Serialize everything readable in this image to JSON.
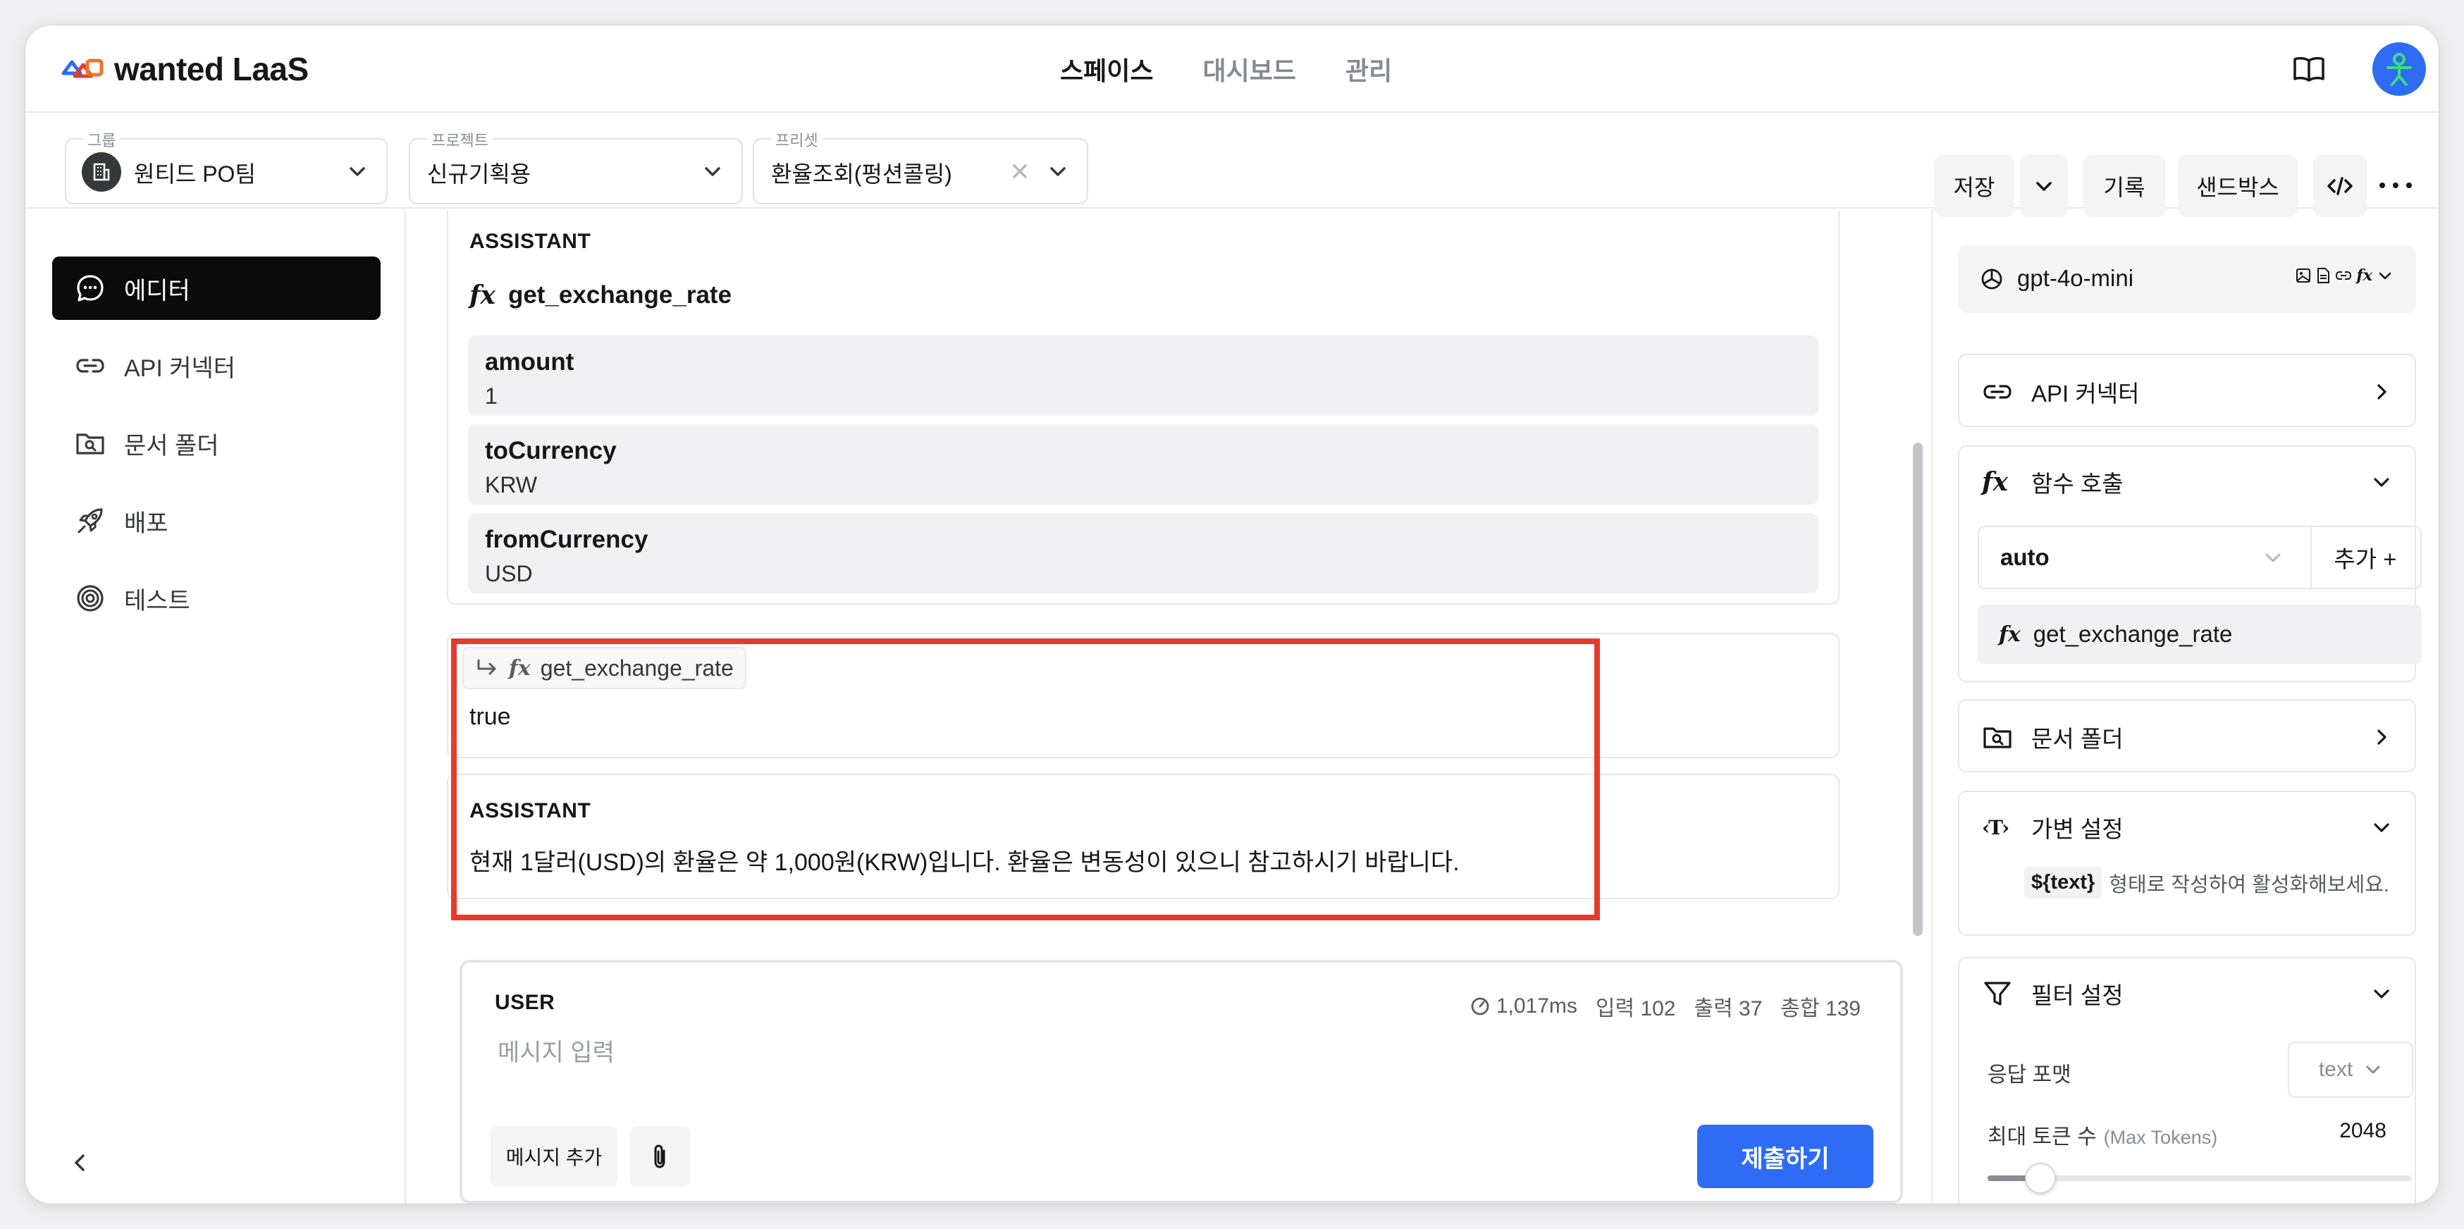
{
  "brand": {
    "name": "wanted LaaS"
  },
  "nav": {
    "items": [
      "스페이스",
      "대시보드",
      "관리"
    ],
    "active": "스페이스"
  },
  "toolbar": {
    "group": {
      "label": "그룹",
      "value": "원티드 PO팀"
    },
    "project": {
      "label": "프로젝트",
      "value": "신규기획용"
    },
    "preset": {
      "label": "프리셋",
      "value": "환율조회(펑션콜링)"
    },
    "save_label": "저장",
    "history_label": "기록",
    "sandbox_label": "샌드박스"
  },
  "sidebar": {
    "items": [
      {
        "label": "에디터",
        "icon": "chat-bubble-icon",
        "active": true
      },
      {
        "label": "API 커넥터",
        "icon": "link-icon"
      },
      {
        "label": "문서 폴더",
        "icon": "folder-search-icon"
      },
      {
        "label": "배포",
        "icon": "rocket-icon"
      },
      {
        "label": "테스트",
        "icon": "target-icon"
      }
    ]
  },
  "messages": {
    "assistant_call": {
      "role": "ASSISTANT",
      "function": "get_exchange_rate",
      "args": [
        {
          "key": "amount",
          "value": "1"
        },
        {
          "key": "toCurrency",
          "value": "KRW"
        },
        {
          "key": "fromCurrency",
          "value": "USD"
        }
      ]
    },
    "tool_result": {
      "function": "get_exchange_rate",
      "content": "true"
    },
    "assistant_reply": {
      "role": "ASSISTANT",
      "content": "현재 1달러(USD)의 환율은 약 1,000원(KRW)입니다. 환율은 변동성이 있으니 참고하시기 바랍니다."
    }
  },
  "input": {
    "role": "USER",
    "latency": "1,017ms",
    "input_tokens": "입력 102",
    "output_tokens": "출력 37",
    "total_tokens": "총합 139",
    "placeholder": "메시지 입력",
    "add_message_label": "메시지 추가",
    "submit_label": "제출하기"
  },
  "right_panel": {
    "model": "gpt-4o-mini",
    "api_connector": "API 커넥터",
    "function_call": {
      "title": "함수 호출",
      "mode": "auto",
      "add_label": "추가 +",
      "functions": [
        "get_exchange_rate"
      ]
    },
    "doc_folder": "문서 폴더",
    "variables": {
      "title": "가변 설정",
      "hint_code": "${text}",
      "hint_text": "형태로 작성하여 활성화해보세요."
    },
    "filter": {
      "title": "필터 설정",
      "response_format_label": "응답 포맷",
      "response_format": "text",
      "max_tokens_label": "최대 토큰 수",
      "max_tokens_sub": "(Max Tokens)",
      "max_tokens_value": "2048",
      "max_tokens_fraction": 0.125
    }
  },
  "colors": {
    "accent": "#2f6cf5",
    "highlight": "#e53a2c",
    "active_nav": "#0b0b0c"
  }
}
